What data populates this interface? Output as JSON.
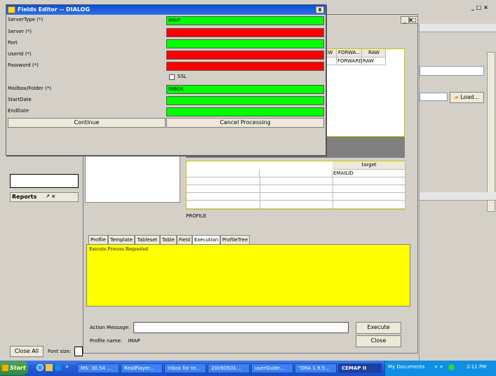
{
  "dialog": {
    "title": "Fields Editor -- DIALOG",
    "close_glyph": "x",
    "fields": [
      {
        "label": "ServerType (*)",
        "value": "IMAP",
        "status": "valid"
      },
      {
        "label": "Server (*)",
        "value": "",
        "status": "invalid"
      },
      {
        "label": "Port",
        "value": "",
        "status": "valid"
      },
      {
        "label": "UserId (*)",
        "value": "",
        "status": "invalid"
      },
      {
        "label": "Password (*)",
        "value": "",
        "status": "invalid"
      },
      {
        "label": "Mailbox/Folder (*)",
        "value": "INBOX",
        "status": "valid"
      },
      {
        "label": "StartDate",
        "value": "",
        "status": "valid"
      },
      {
        "label": "EndDate",
        "value": "",
        "status": "valid"
      }
    ],
    "ssl_label": "SSL",
    "continue_label": "Continue",
    "cancel_label": "Cancel Processing"
  },
  "colors": {
    "valid": "#00ff00",
    "invalid": "#ff0000",
    "log_bg": "#ffff00",
    "title_bar": "#0a4fd3"
  },
  "background": {
    "window_controls": "_ □ ×",
    "panel_controls": "↗ □ ×",
    "top_table": {
      "headers": [
        "NEW",
        "FORWA...",
        "RAW"
      ],
      "row": [
        "IEW",
        "FORWARD",
        "RAW"
      ]
    },
    "load_label": "Load...",
    "bottom_table": {
      "header": "target",
      "rows": [
        [
          "",
          "",
          "EMAILID"
        ],
        [
          "",
          "",
          ""
        ],
        [
          "",
          "",
          ""
        ],
        [
          "",
          "",
          ""
        ],
        [
          "",
          "",
          ""
        ]
      ]
    },
    "profile_caption": "PROFILE",
    "tabs": [
      "Profile",
      "Template",
      "Tableset",
      "Table",
      "Field",
      "Execution",
      "ProfileTree"
    ],
    "active_tab": "Execution",
    "log_text": "Execute Process Requested",
    "action_message_label": "Action Message:",
    "action_message_value": "",
    "execute_label": "Execute",
    "profile_name_label": "Profile name:",
    "profile_name_value": "IMAP",
    "close_label": "Close",
    "reports_label": "Reports",
    "reports_controls": "↗ ×",
    "close_all_label": "Close All",
    "font_size_label": "Font size:"
  },
  "taskbar": {
    "start_label": "Start",
    "items": [
      "MS: 30.54 ...",
      "RealPlayer...",
      "Inbox for te...",
      "20090501...",
      "userGuide...",
      "\"ORA 1.9.5...",
      "CEMAP II"
    ],
    "my_documents": "My Documents",
    "time": "2:11 PM"
  }
}
